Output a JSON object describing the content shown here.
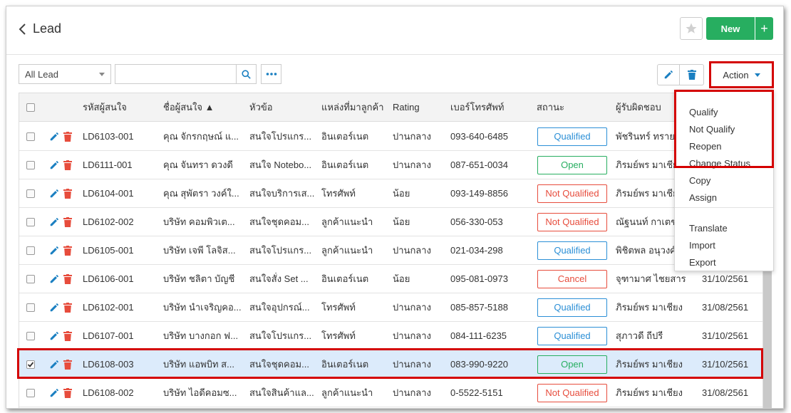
{
  "header": {
    "title": "Lead",
    "new_label": "New",
    "new_plus": "+"
  },
  "toolbar": {
    "filter_value": "All Lead",
    "search_placeholder": "",
    "action_label": "Action"
  },
  "columns": [
    "รหัสผู้สนใจ",
    "ชื่อผู้สนใจ ▲",
    "หัวข้อ",
    "แหล่งที่มาลูกค้า",
    "Rating",
    "เบอร์โทรศัพท์",
    "สถานะ",
    "ผู้รับผิดชอบ"
  ],
  "rows": [
    {
      "code": "LD6103-001",
      "name": "คุณ จักรกฤษณ์ แ...",
      "topic": "สนใจโปรแกร...",
      "source": "อินเตอร์เนต",
      "rating": "ปานกลาง",
      "phone": "093-640-6485",
      "status": "Qualified",
      "owner": "พัชรินทร์ ทรายท",
      "date": ""
    },
    {
      "code": "LD6111-001",
      "name": "คุณ จันทรา ดวงดี",
      "topic": "สนใจ Notebo...",
      "source": "อินเตอร์เนต",
      "rating": "ปานกลาง",
      "phone": "087-651-0034",
      "status": "Open",
      "owner": "ภิรมย์พร มาเชีย",
      "date": ""
    },
    {
      "code": "LD6104-001",
      "name": "คุณ สุพัตรา วงค์ใ...",
      "topic": "สนใจบริการเส...",
      "source": "โทรศัพท์",
      "rating": "น้อย",
      "phone": "093-149-8856",
      "status": "Not Qualified",
      "owner": "ภิรมย์พร มาเชีย",
      "date": ""
    },
    {
      "code": "LD6102-002",
      "name": "บริษัท คอมพิวเต...",
      "topic": "สนใจชุดคอม...",
      "source": "ลูกค้าแนะนำ",
      "rating": "น้อย",
      "phone": "056-330-053",
      "status": "Not Qualified",
      "owner": "ณัฐนนท์ กาเตช",
      "date": ""
    },
    {
      "code": "LD6105-001",
      "name": "บริษัท เจพี โลจิส...",
      "topic": "สนใจโปรแกร...",
      "source": "ลูกค้าแนะนำ",
      "rating": "ปานกลาง",
      "phone": "021-034-298",
      "status": "Qualified",
      "owner": "พิชิตพล อนุวงศ์",
      "date": ""
    },
    {
      "code": "LD6106-001",
      "name": "บริษัท ชลิตา บัญชี",
      "topic": "สนใจสั่ง Set ...",
      "source": "อินเตอร์เนต",
      "rating": "น้อย",
      "phone": "095-081-0973",
      "status": "Cancel",
      "owner": "จุฑามาศ ไชยสาร",
      "date": "31/10/2561"
    },
    {
      "code": "LD6102-001",
      "name": "บริษัท นำเจริญคอ...",
      "topic": "สนใจอุปกรณ์...",
      "source": "โทรศัพท์",
      "rating": "ปานกลาง",
      "phone": "085-857-5188",
      "status": "Qualified",
      "owner": "ภิรมย์พร มาเชียง",
      "date": "31/08/2561"
    },
    {
      "code": "LD6107-001",
      "name": "บริษัท บางกอก ฟ...",
      "topic": "สนใจโปรแกร...",
      "source": "โทรศัพท์",
      "rating": "ปานกลาง",
      "phone": "084-111-6235",
      "status": "Qualified",
      "owner": "สุภาวดี ถีปรี",
      "date": "31/10/2561"
    },
    {
      "code": "LD6108-003",
      "name": "บริษัท แอพบิท ส...",
      "topic": "สนใจชุดคอม...",
      "source": "อินเตอร์เนต",
      "rating": "ปานกลาง",
      "phone": "083-990-9220",
      "status": "Open",
      "owner": "ภิรมย์พร มาเชียง",
      "date": "31/10/2561"
    },
    {
      "code": "LD6108-002",
      "name": "บริษัท ไอดีคอมซ...",
      "topic": "สนใจสินค้าแล...",
      "source": "ลูกค้าแนะนำ",
      "rating": "ปานกลาง",
      "phone": "0-5522-5151",
      "status": "Not Qualified",
      "owner": "ภิรมย์พร มาเชียง",
      "date": "31/08/2561"
    }
  ],
  "action_menu": [
    "Qualify",
    "Not Qualify",
    "Reopen",
    "Change Status",
    "Copy",
    "Assign",
    "Translate",
    "Import",
    "Export"
  ],
  "colors": {
    "accent": "#27ae60",
    "link_blue": "#1a7fc1",
    "delete_red": "#e74c3c",
    "selected_row": "#dcebfb",
    "highlight_red": "#d40000"
  }
}
